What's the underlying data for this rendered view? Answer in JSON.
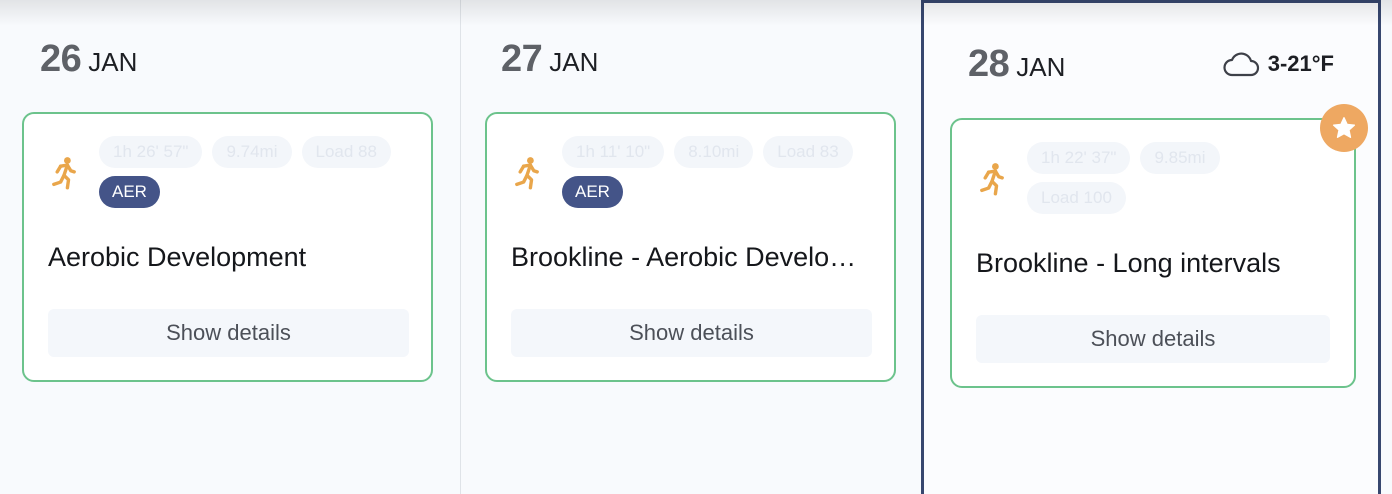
{
  "days": [
    {
      "day": "26",
      "month": "JAN",
      "workout": {
        "chips": [
          "1h 26' 57\"",
          "9.74mi",
          "Load 88"
        ],
        "tag": "AER",
        "title": "Aerobic Development",
        "details_label": "Show details"
      }
    },
    {
      "day": "27",
      "month": "JAN",
      "workout": {
        "chips": [
          "1h 11' 10\"",
          "8.10mi",
          "Load 83"
        ],
        "tag": "AER",
        "title": "Brookline - Aerobic Development",
        "details_label": "Show details"
      }
    },
    {
      "day": "28",
      "month": "JAN",
      "weather": {
        "icon": "cloud-icon",
        "temp": "3-21°F"
      },
      "workout": {
        "chips": [
          "1h 22' 37\"",
          "9.85mi",
          "Load 100"
        ],
        "title": "Brookline - Long intervals",
        "details_label": "Show details",
        "badge_icon": "star-icon"
      }
    }
  ],
  "colors": {
    "card_border": "#6cc38c",
    "tag_bg": "#445488",
    "today_border": "#37476f",
    "run_icon": "#e9a64b",
    "star_badge": "#eea862"
  }
}
